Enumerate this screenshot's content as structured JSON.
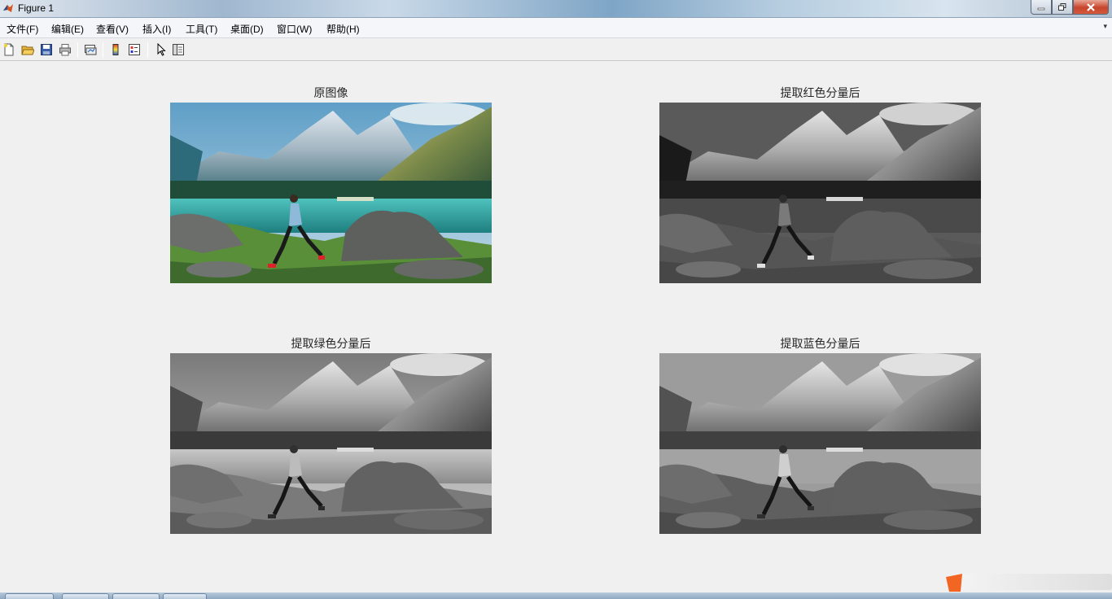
{
  "window": {
    "title": "Figure 1",
    "icon": "matlab-icon"
  },
  "menubar": {
    "items": [
      {
        "label": "文件(F)"
      },
      {
        "label": "编辑(E)"
      },
      {
        "label": "查看(V)"
      },
      {
        "label": "插入(I)"
      },
      {
        "label": "工具(T)"
      },
      {
        "label": "桌面(D)"
      },
      {
        "label": "窗口(W)"
      },
      {
        "label": "帮助(H)"
      }
    ],
    "overflow_icon": "chevron-icon"
  },
  "toolbar": {
    "tools": [
      {
        "name": "new-figure-icon"
      },
      {
        "name": "open-file-icon"
      },
      {
        "name": "save-icon"
      },
      {
        "name": "print-icon"
      },
      {
        "name": "link-plot-icon"
      },
      {
        "name": "colorbar-icon"
      },
      {
        "name": "legend-icon"
      },
      {
        "name": "edit-plot-icon"
      },
      {
        "name": "property-editor-icon"
      }
    ]
  },
  "subplots": [
    {
      "title": "原图像",
      "channel": "rgb"
    },
    {
      "title": "提取红色分量后",
      "channel": "red"
    },
    {
      "title": "提取绿色分量后",
      "channel": "green"
    },
    {
      "title": "提取蓝色分量后",
      "channel": "blue"
    }
  ],
  "colors": {
    "figure_bg": "#f0f0f0",
    "title_text": "#262626",
    "sky": "#6fa8c9",
    "lake": "#3aa7a6",
    "forest": "#1f4d3a",
    "grass": "#4f8a35",
    "rock": "#6b6e6a",
    "shoe": "#e0202a"
  }
}
